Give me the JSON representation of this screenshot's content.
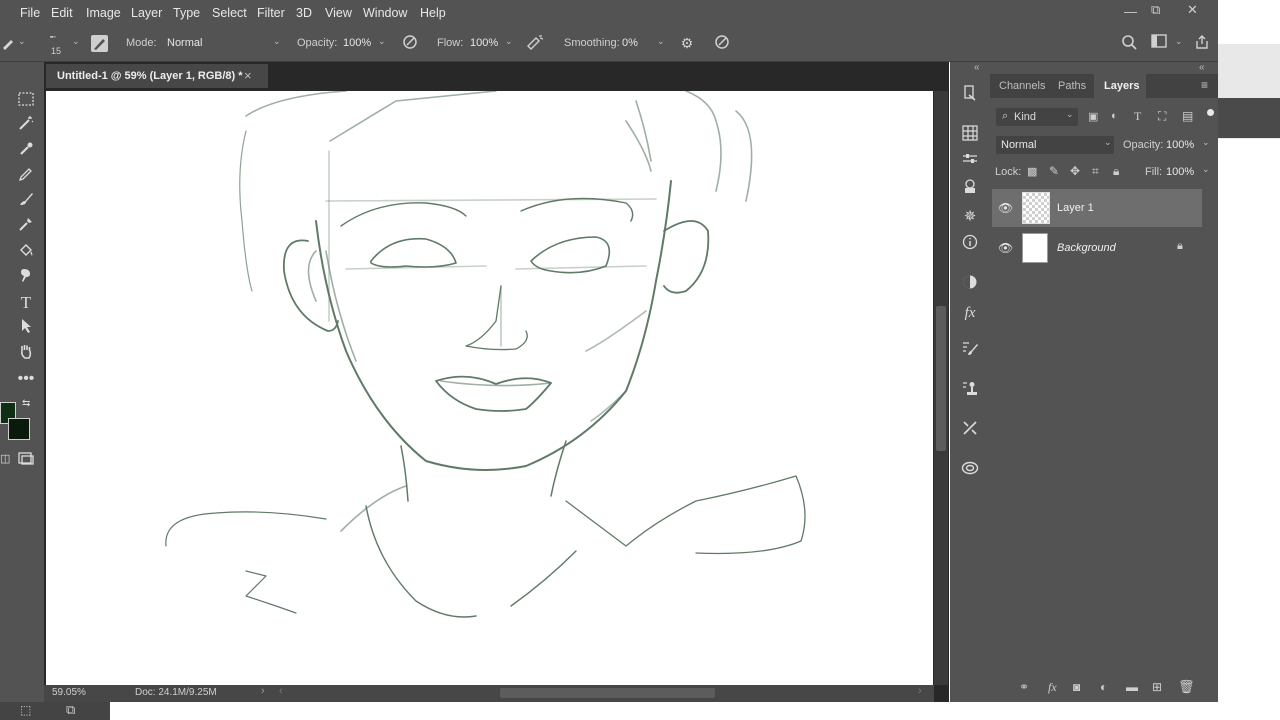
{
  "menubar": {
    "items": [
      "File",
      "Edit",
      "Image",
      "Layer",
      "Type",
      "Select",
      "Filter",
      "3D",
      "View",
      "Window",
      "Help"
    ],
    "window_controls": {
      "minimize": "—",
      "restore": "⧉",
      "close": "✕"
    }
  },
  "options": {
    "brush_size": "15",
    "mode_label": "Mode:",
    "mode_value": "Normal",
    "opacity_label": "Opacity:",
    "opacity_value": "100%",
    "flow_label": "Flow:",
    "flow_value": "100%",
    "smoothing_label": "Smoothing:",
    "smoothing_value": "0%"
  },
  "document": {
    "tab_title": "Untitled-1 @ 59% (Layer 1, RGB/8) *",
    "tab_close": "×",
    "zoom": "59.05%",
    "doc_info": "Doc: 24.1M/9.25M"
  },
  "colors": {
    "foreground": "#0f2f14",
    "background": "#0a1a0d",
    "sketch_stroke": "#5f7a66"
  },
  "layers_panel": {
    "tabs": [
      "Channels",
      "Paths",
      "Layers"
    ],
    "active_tab": "Layers",
    "filter_kind": "Kind",
    "blend_mode": "Normal",
    "opacity_label": "Opacity:",
    "opacity_value": "100%",
    "lock_label": "Lock:",
    "fill_label": "Fill:",
    "fill_value": "100%",
    "layers": [
      {
        "name": "Layer 1",
        "selected": true
      },
      {
        "name": "Background",
        "selected": false
      }
    ]
  }
}
